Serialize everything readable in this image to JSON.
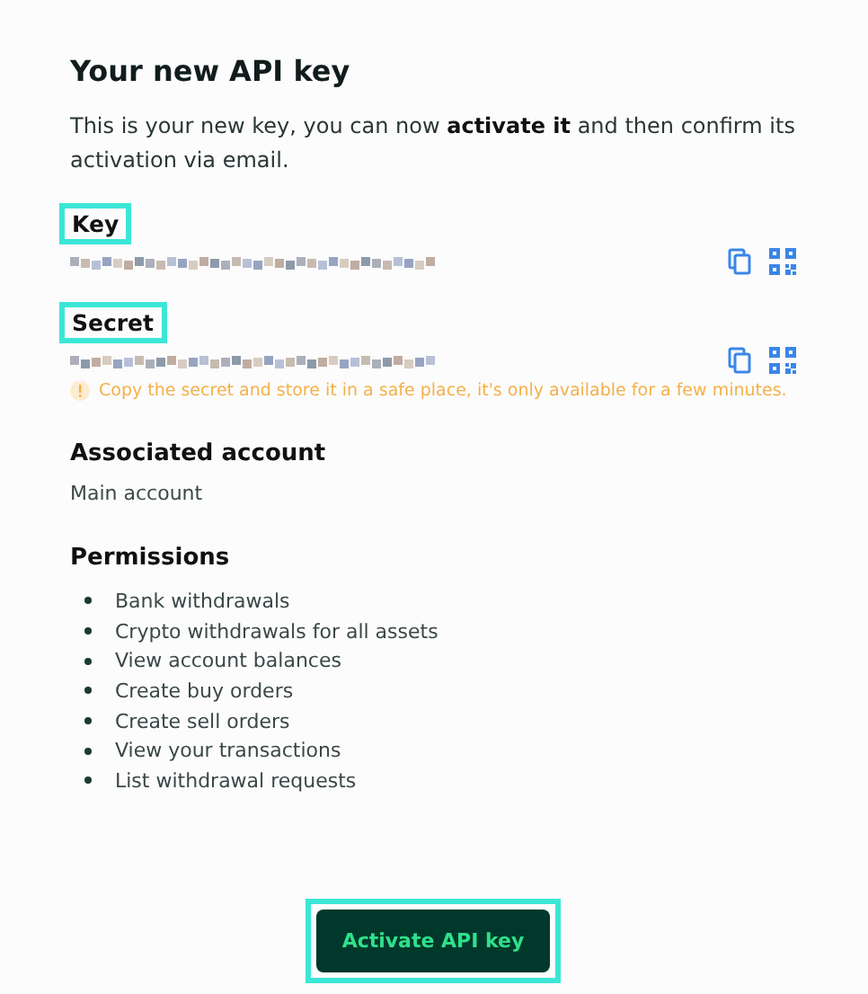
{
  "title": "Your new API key",
  "intro": "This is your new key, you can now **activate it** and then confirm its activation via email.",
  "credentials": [
    {
      "label": "Key",
      "highlighted": true,
      "masked": true
    },
    {
      "label": "Secret",
      "highlighted": true,
      "masked": true,
      "warning": "Copy the secret and store it in a safe place, it's only available for a few minutes."
    }
  ],
  "account": {
    "heading": "Associated account",
    "value": "Main account"
  },
  "permissions": {
    "heading": "Permissions",
    "items": [
      "Bank withdrawals",
      "Crypto withdrawals for all assets",
      "View account balances",
      "Create buy orders",
      "Create sell orders",
      "View your transactions",
      "List withdrawal requests"
    ]
  },
  "button": {
    "label": "Activate API key",
    "highlighted": true
  }
}
